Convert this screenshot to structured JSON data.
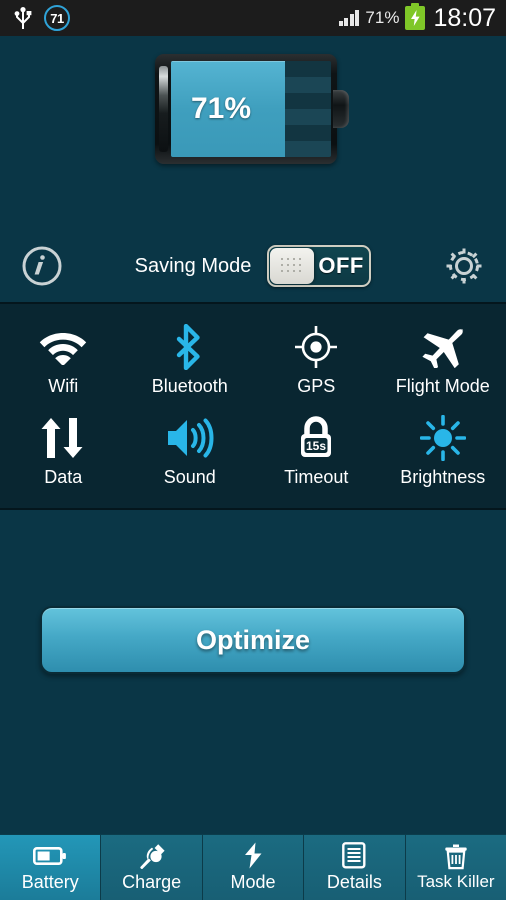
{
  "statusbar": {
    "usb_icon": "usb-icon",
    "badge_count": "71",
    "signal_icon": "signal-bars-icon",
    "battery_percent_text": "71%",
    "battery_icon": "charging-battery-icon",
    "clock": "18:07"
  },
  "battery": {
    "percent_label": "71%",
    "percent_value": 71,
    "fill_color": "#45a8c6",
    "icon": "battery-level-icon"
  },
  "saving_mode": {
    "info_icon": "info-icon",
    "label": "Saving Mode",
    "toggle_state": "OFF",
    "settings_icon": "gear-icon"
  },
  "toggles": [
    {
      "label": "Wifi",
      "icon": "wifi-icon",
      "color": "#ffffff"
    },
    {
      "label": "Bluetooth",
      "icon": "bluetooth-icon",
      "color": "#29b6e8"
    },
    {
      "label": "GPS",
      "icon": "gps-icon",
      "color": "#ffffff"
    },
    {
      "label": "Flight Mode",
      "icon": "airplane-icon",
      "color": "#ffffff"
    },
    {
      "label": "Data",
      "icon": "data-arrows-icon",
      "color": "#ffffff"
    },
    {
      "label": "Sound",
      "icon": "speaker-icon",
      "color": "#29b6e8"
    },
    {
      "label": "Timeout",
      "icon": "lock-timeout-icon",
      "color": "#ffffff",
      "badge": "15s"
    },
    {
      "label": "Brightness",
      "icon": "sun-icon",
      "color": "#29b6e8"
    }
  ],
  "optimize_button": {
    "label": "Optimize",
    "color": "#45a8c6"
  },
  "tabs": [
    {
      "label": "Battery",
      "icon": "battery-icon",
      "active": true
    },
    {
      "label": "Charge",
      "icon": "plug-icon",
      "active": false
    },
    {
      "label": "Mode",
      "icon": "bolt-icon",
      "active": false
    },
    {
      "label": "Details",
      "icon": "document-icon",
      "active": false
    },
    {
      "label": "Task Killer",
      "icon": "trash-icon",
      "active": false
    }
  ],
  "theme": {
    "background": "#0a3646",
    "panel": "#092631",
    "accent": "#29b6e8",
    "statusbar": "#1c1c1c"
  }
}
